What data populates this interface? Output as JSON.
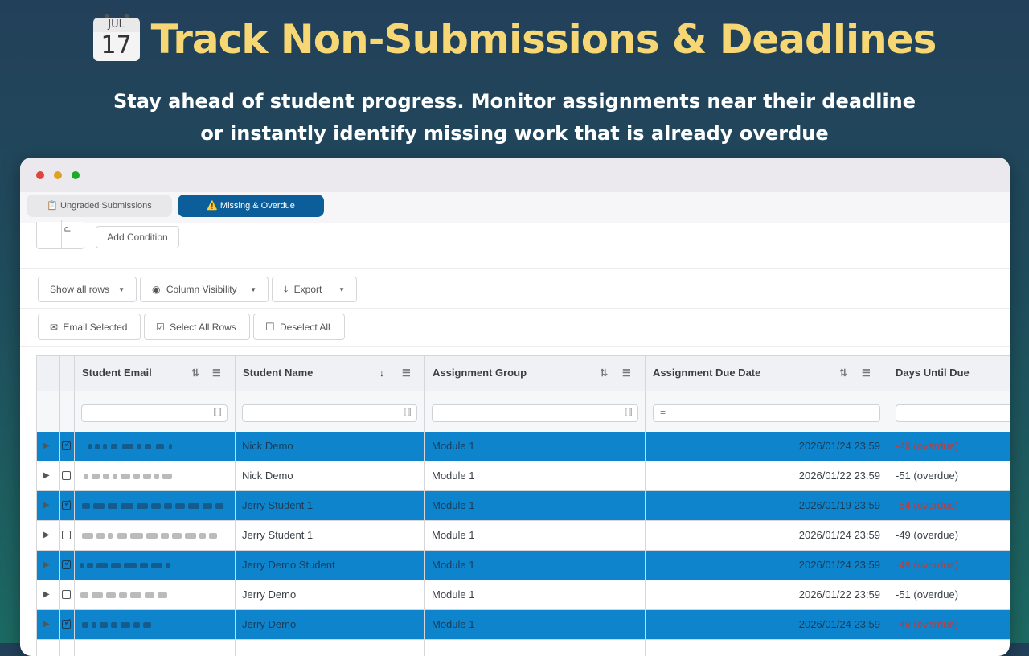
{
  "hero": {
    "calendar_month": "JUL",
    "calendar_day": "17",
    "title": "Track Non-Submissions & Deadlines",
    "subtitle_line1": "Stay ahead of student progress. Monitor assignments near their deadline",
    "subtitle_line2": "or instantly identify missing work that is already overdue"
  },
  "window": {
    "traffic_lights": [
      "#e0443e",
      "#dea123",
      "#1aab29"
    ],
    "tabs": [
      {
        "icon": "📋",
        "label": "Ungraded Submissions",
        "active": false
      },
      {
        "icon": "⚠️",
        "label": "Missing & Overdue",
        "active": true
      }
    ]
  },
  "toolbar": {
    "partial_char": "P",
    "add_condition": "Add Condition",
    "show_all_rows": "Show all rows",
    "column_visibility": "Column Visibility",
    "export": "Export",
    "email_selected": "Email Selected",
    "select_all_rows": "Select All Rows",
    "deselect_all": "Deselect All"
  },
  "table": {
    "columns": [
      "Student Email",
      "Student Name",
      "Assignment Group",
      "Assignment Due Date",
      "Days Until Due"
    ],
    "rows": [
      {
        "selected": true,
        "name": "Nick Demo",
        "group": "Module 1",
        "due": "2026/01/24 23:59",
        "days": "-49 (overdue)"
      },
      {
        "selected": false,
        "name": "Nick Demo",
        "group": "Module 1",
        "due": "2026/01/22 23:59",
        "days": "-51 (overdue)"
      },
      {
        "selected": true,
        "name": "Jerry Student 1",
        "group": "Module 1",
        "due": "2026/01/19 23:59",
        "days": "-54 (overdue)"
      },
      {
        "selected": false,
        "name": "Jerry Student 1",
        "group": "Module 1",
        "due": "2026/01/24 23:59",
        "days": "-49 (overdue)"
      },
      {
        "selected": true,
        "name": "Jerry Demo Student",
        "group": "Module 1",
        "due": "2026/01/24 23:59",
        "days": "-49 (overdue)"
      },
      {
        "selected": false,
        "name": "Jerry Demo",
        "group": "Module 1",
        "due": "2026/01/22 23:59",
        "days": "-51 (overdue)"
      },
      {
        "selected": true,
        "name": "Jerry Demo",
        "group": "Module 1",
        "due": "2026/01/24 23:59",
        "days": "-49 (overdue)"
      }
    ]
  },
  "colors": {
    "accent": "#0b5e99",
    "selected_row": "#0d84cc",
    "overdue": "#d93939",
    "hero_title": "#f7d774"
  }
}
